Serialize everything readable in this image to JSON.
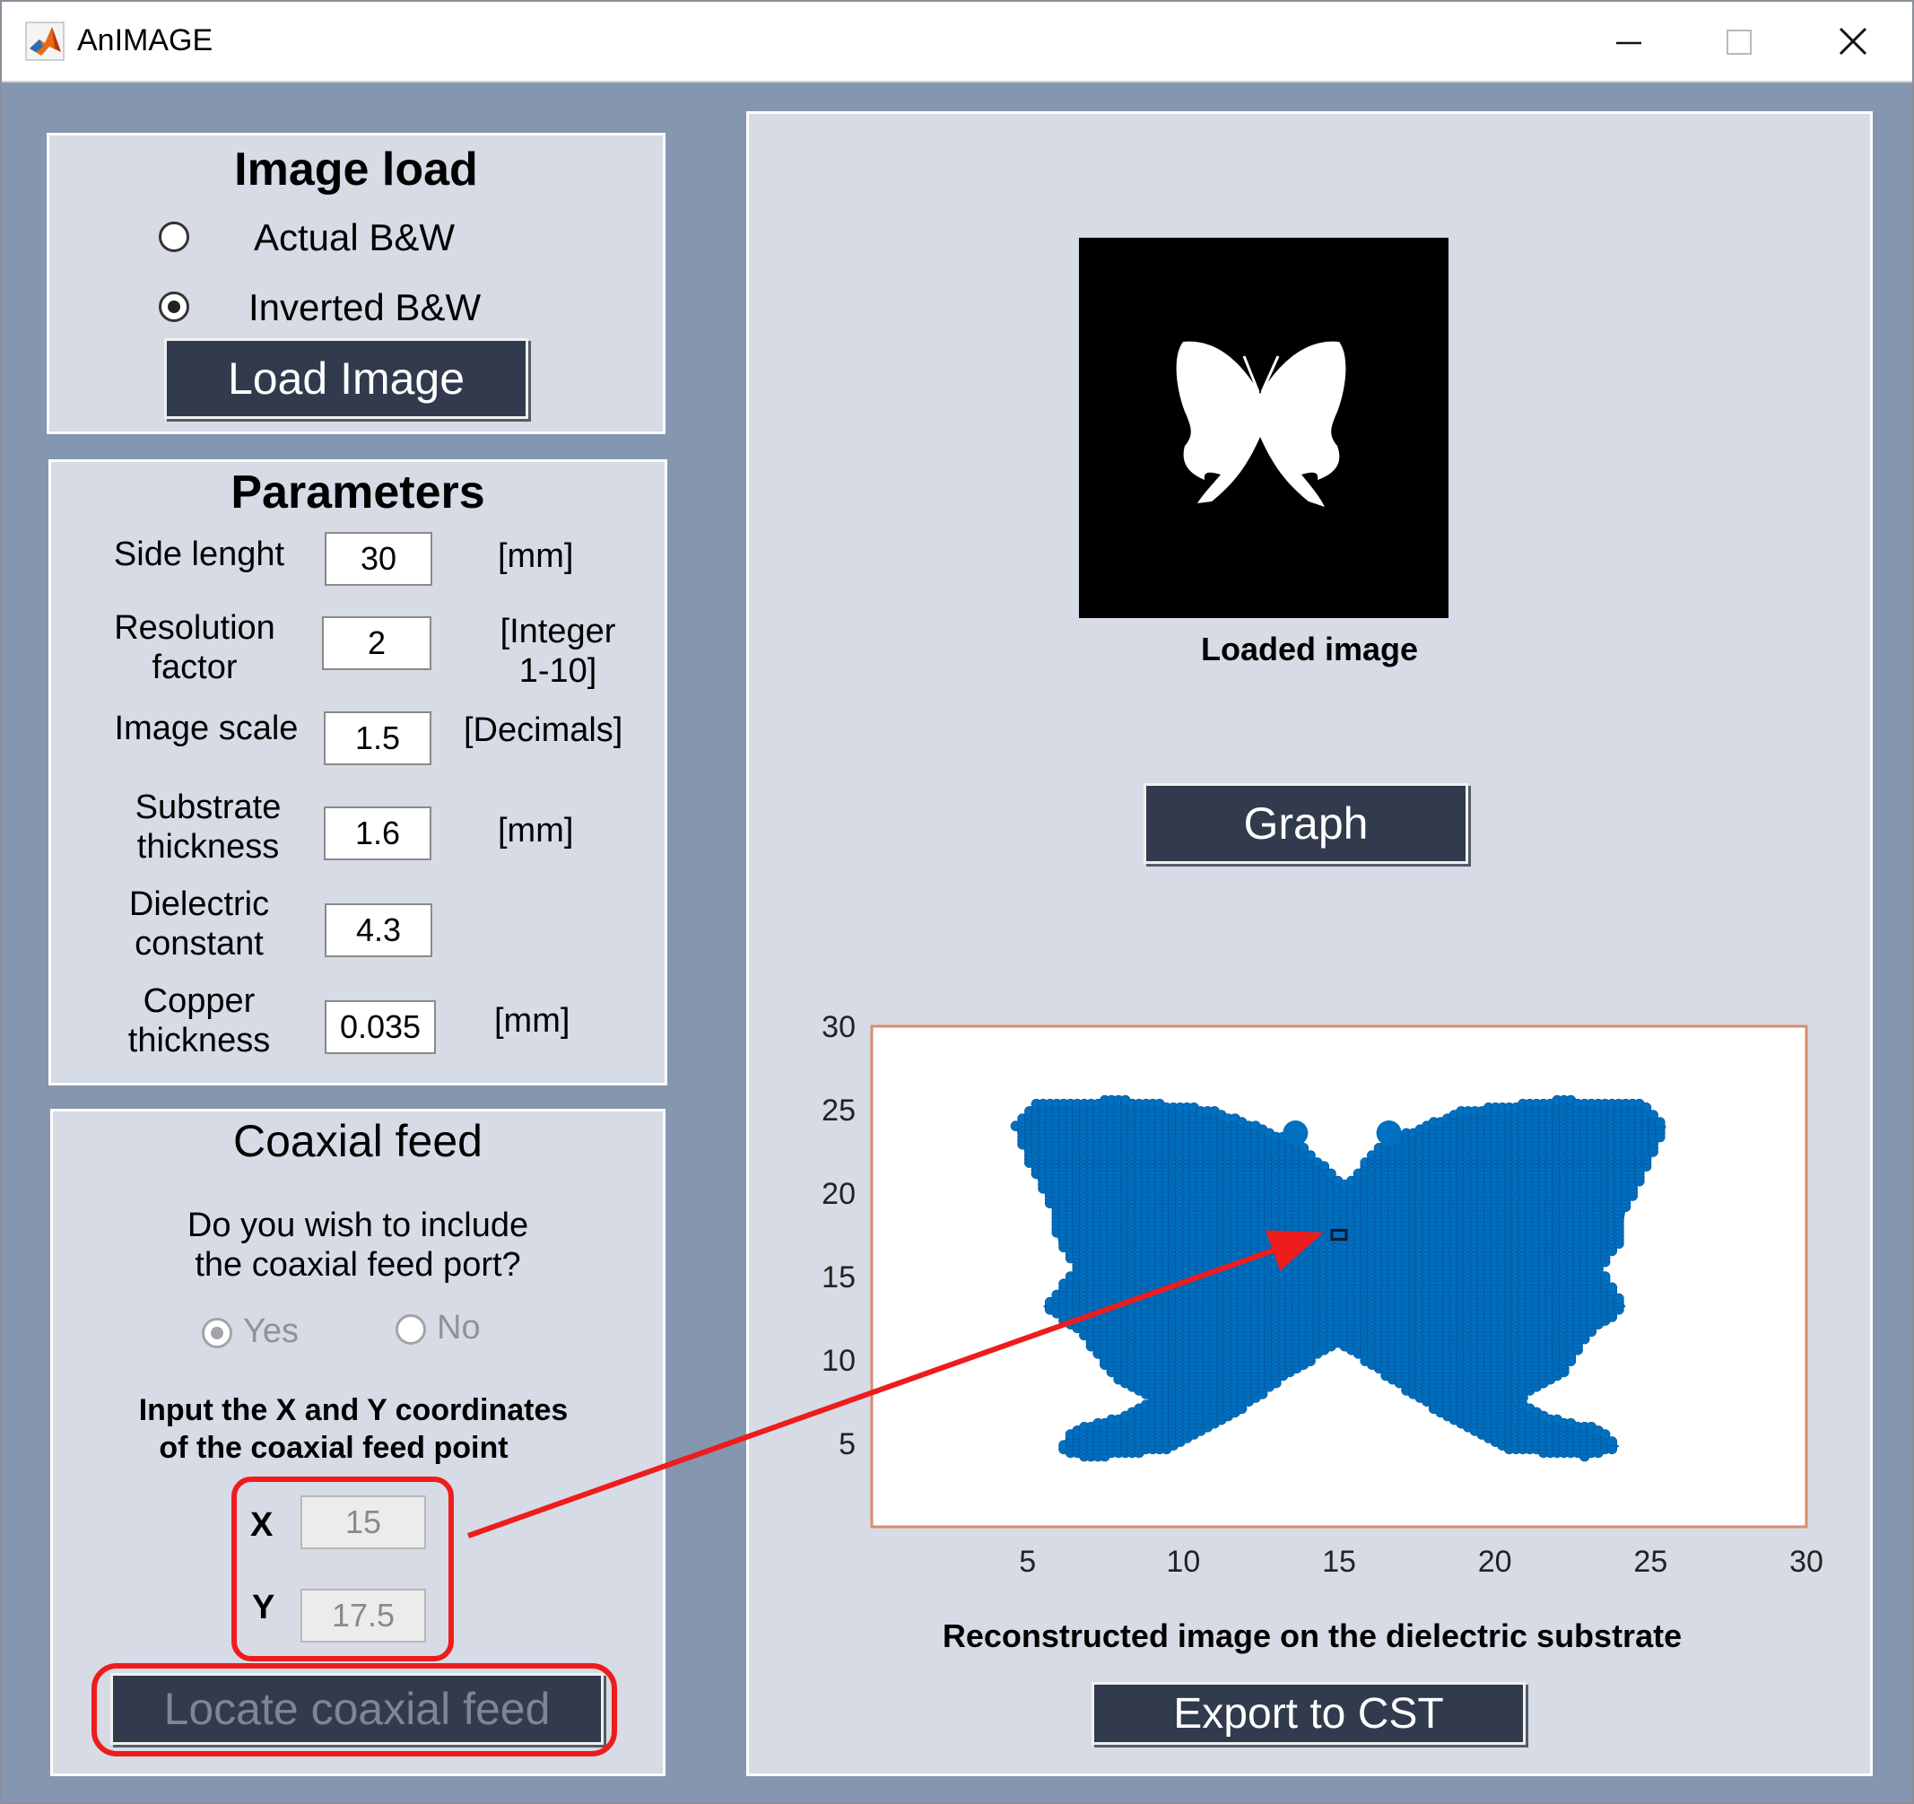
{
  "window": {
    "title": "AnIMAGE",
    "app_icon": "matlab-icon",
    "controls": [
      "minimize-icon",
      "maximize-icon",
      "close-icon"
    ]
  },
  "image_load": {
    "title": "Image load",
    "options": [
      {
        "label": "Actual B&W",
        "checked": false
      },
      {
        "label": "Inverted B&W",
        "checked": true
      }
    ],
    "load_button": "Load Image"
  },
  "parameters": {
    "title": "Parameters",
    "rows": [
      {
        "label": [
          "Side lenght"
        ],
        "value": "30",
        "unit": [
          "[mm]"
        ]
      },
      {
        "label": [
          "Resolution",
          "factor"
        ],
        "value": "2",
        "unit": [
          "[Integer",
          "1-10]"
        ]
      },
      {
        "label": [
          "Image scale"
        ],
        "value": "1.5",
        "unit": [
          "[Decimals]"
        ]
      },
      {
        "label": [
          "Substrate",
          "thickness"
        ],
        "value": "1.6",
        "unit": [
          "[mm]"
        ]
      },
      {
        "label": [
          "Dielectric",
          "constant"
        ],
        "value": "4.3",
        "unit": []
      },
      {
        "label": [
          "Copper",
          "thickness"
        ],
        "value": "0.035",
        "unit": [
          "[mm]"
        ]
      }
    ]
  },
  "coaxial": {
    "title": "Coaxial feed",
    "question": [
      "Do you wish to include",
      "the coaxial feed port?"
    ],
    "options": [
      {
        "label": "Yes",
        "checked": true
      },
      {
        "label": "No",
        "checked": false
      }
    ],
    "instruction": [
      "Input the X and Y coordinates",
      "of the coaxial feed point"
    ],
    "x_label": "X",
    "x_value": "15",
    "y_label": "Y",
    "y_value": "17.5",
    "locate_button": "Locate coaxial feed"
  },
  "right_panel": {
    "loaded_caption": "Loaded image",
    "graph_button": "Graph",
    "plot_caption": "Reconstructed image on the dielectric substrate",
    "export_button": "Export to CST"
  },
  "colors": {
    "window_bg": "#8496b0",
    "panel_bg": "#d6dbe5",
    "button_bg": "#323b4d",
    "butterfly_fill": "#0070c0",
    "annotation": "#ee1c1c",
    "axes_box": "#d98c6e"
  },
  "chart_data": {
    "type": "scatter",
    "title": "",
    "caption": "Reconstructed image on the dielectric substrate",
    "xlabel": "",
    "ylabel": "",
    "xlim": [
      0,
      30
    ],
    "ylim": [
      0,
      30
    ],
    "xticks": [
      5,
      10,
      15,
      20,
      25,
      30
    ],
    "yticks": [
      5,
      10,
      15,
      20,
      25,
      30
    ],
    "grid": false,
    "series": [
      {
        "color": "#0070c0",
        "shape": "butterfly silhouette",
        "x_extent": [
          4.5,
          25.8
        ],
        "y_extent": [
          4.2,
          25.6
        ]
      }
    ],
    "feed_point": {
      "x": 15,
      "y": 17.5
    }
  }
}
